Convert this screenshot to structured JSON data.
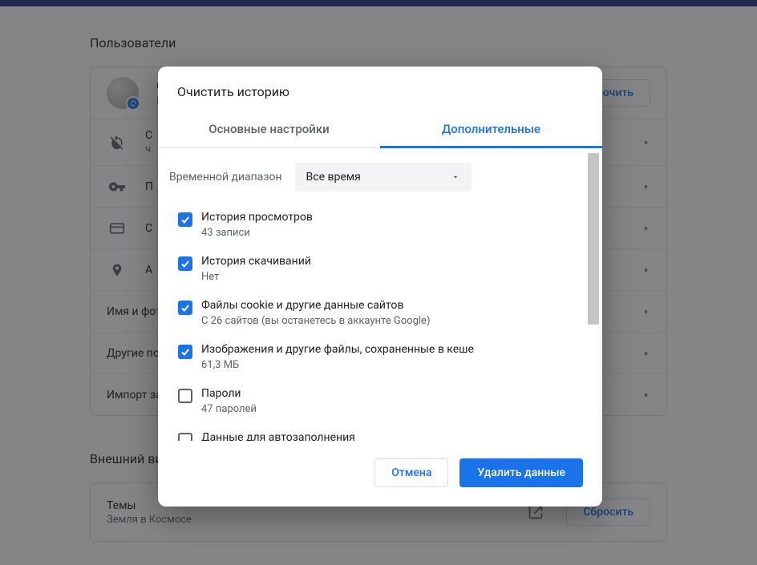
{
  "sections": {
    "users_heading": "Пользователи",
    "appearance_heading": "Внешний вид"
  },
  "profile_row": {
    "title_fragment": "C",
    "subtitle_fragment": "in",
    "action_fragment": "лючить"
  },
  "rows": {
    "sync": {
      "title": "С",
      "sub": "ч"
    },
    "passwords": {
      "title": "П"
    },
    "payment": {
      "title": "С"
    },
    "addresses": {
      "title": "А"
    },
    "name_photo": {
      "title": "Имя и фот"
    },
    "other": {
      "title": "Другие по"
    },
    "import": {
      "title": "Импорт за"
    }
  },
  "appearance": {
    "theme_title": "Темы",
    "theme_sub": "Земля в Космосе",
    "reset_label": "Сбросить"
  },
  "dialog": {
    "title": "Очистить историю",
    "tab_basic": "Основные настройки",
    "tab_advanced": "Дополнительные",
    "range_label": "Временной диапазон",
    "range_value": "Все время",
    "options": [
      {
        "title": "История просмотров",
        "sub": "43 записи",
        "checked": true
      },
      {
        "title": "История скачиваний",
        "sub": "Нет",
        "checked": true
      },
      {
        "title": "Файлы cookie и другие данные сайтов",
        "sub": "С 26 сайтов (вы останетесь в аккаунте Google)",
        "checked": true
      },
      {
        "title": "Изображения и другие файлы, сохраненные в кеше",
        "sub": "61,3 МБ",
        "checked": true
      },
      {
        "title": "Пароли",
        "sub": "47 паролей",
        "checked": false
      },
      {
        "title": "Данные для автозаполнения",
        "sub": "",
        "checked": false
      }
    ],
    "cancel": "Отмена",
    "confirm": "Удалить данные"
  }
}
